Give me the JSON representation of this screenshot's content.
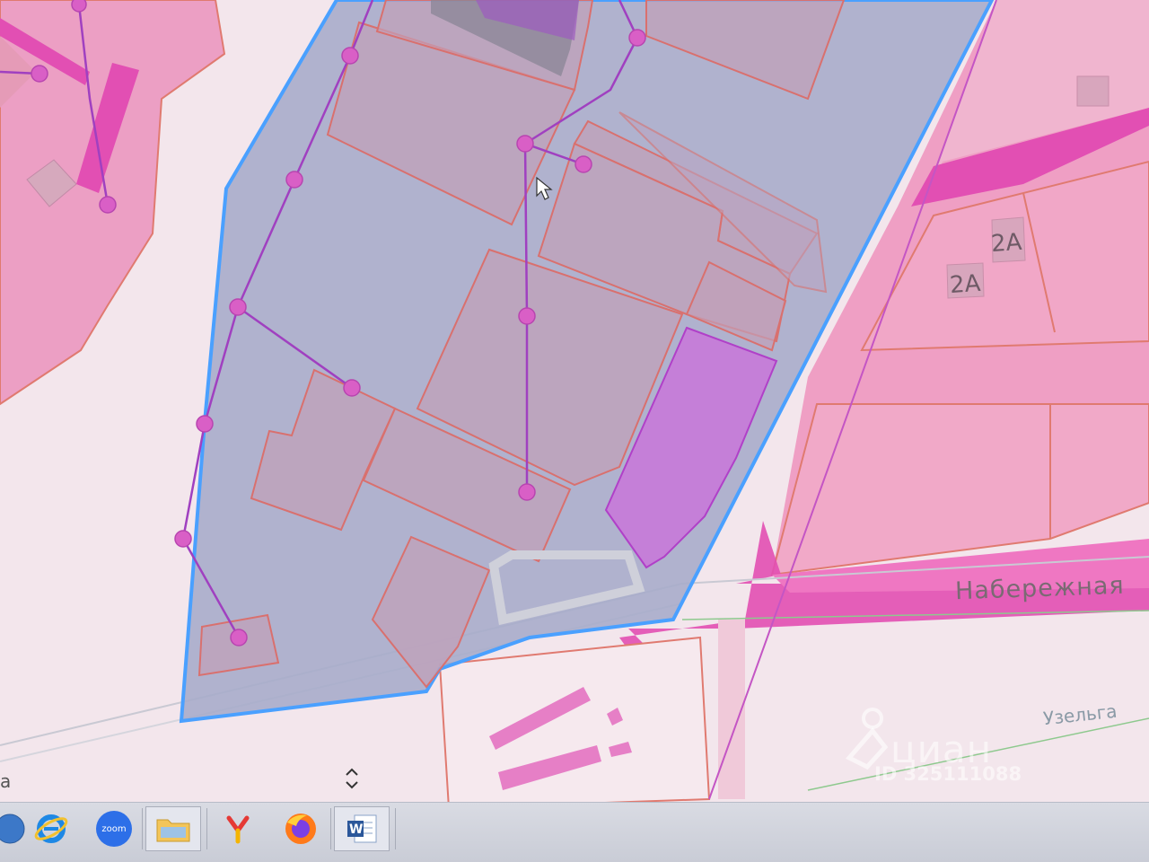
{
  "map": {
    "building_labels": [
      "2А",
      "2А"
    ],
    "street_labels": [
      "Набережная",
      "Узельга"
    ],
    "edge_text": "а",
    "colors": {
      "zone_fill": "#ea9ec4",
      "zone_fill_light": "#f2c3d6",
      "parcel_border": "#e07a70",
      "road_magenta": "#e24fb3",
      "selection_fill": "#a5abc9",
      "selection_border": "#4aa0ff",
      "network_line": "#a040c0",
      "network_node": "#d95fc6",
      "highlight_building": "#c57fd8"
    },
    "icons": [
      "scroll-arrows-icon",
      "mouse-cursor-icon"
    ]
  },
  "watermark": {
    "brand": "циан",
    "listing_id": "ID 325111088"
  },
  "taskbar": {
    "items": [
      {
        "name": "start-button",
        "icon": "start-icon"
      },
      {
        "name": "internet-explorer-button",
        "icon": "internet-explorer-icon"
      },
      {
        "name": "zoom-button",
        "icon": "zoom-icon",
        "label": "zoom"
      },
      {
        "name": "file-explorer-button",
        "icon": "folder-icon"
      },
      {
        "name": "yandex-browser-button",
        "icon": "yandex-icon",
        "label": "Y"
      },
      {
        "name": "firefox-button",
        "icon": "firefox-icon"
      },
      {
        "name": "word-button",
        "icon": "word-icon",
        "label": "W"
      }
    ]
  }
}
